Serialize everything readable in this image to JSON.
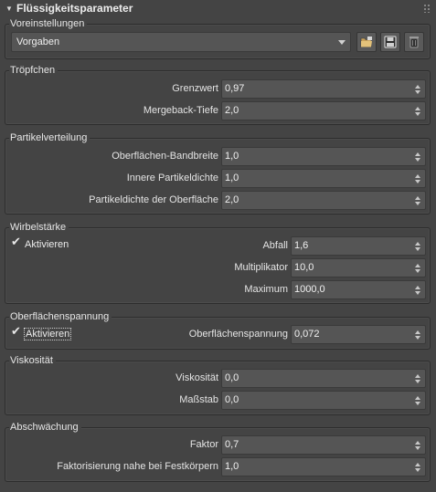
{
  "rollout": {
    "title": "Flüssigkeitsparameter"
  },
  "presets": {
    "title": "Voreinstellungen",
    "selected": "Vorgaben",
    "icons": [
      "folder-open-icon",
      "save-icon",
      "delete-icon"
    ]
  },
  "droplets": {
    "title": "Tröpfchen",
    "threshold_label": "Grenzwert",
    "threshold_value": "0,97",
    "merge_label": "Mergeback-Tiefe",
    "merge_value": "2,0"
  },
  "particle_distribution": {
    "title": "Partikelverteilung",
    "surface_band_label": "Oberflächen-Bandbreite",
    "surface_band_value": "1,0",
    "inner_density_label": "Innere Partikeldichte",
    "inner_density_value": "1,0",
    "surface_density_label": "Partikeldichte der Oberfläche",
    "surface_density_value": "2,0"
  },
  "vorticity": {
    "title": "Wirbelstärke",
    "enable_label": "Aktivieren",
    "enabled": true,
    "falloff_label": "Abfall",
    "falloff_value": "1,6",
    "multiplier_label": "Multiplikator",
    "multiplier_value": "10,0",
    "maximum_label": "Maximum",
    "maximum_value": "1000,0"
  },
  "surface_tension": {
    "title": "Oberflächenspannung",
    "enable_label": "Aktivieren",
    "enabled": true,
    "tension_label": "Oberflächenspannung",
    "tension_value": "0,072"
  },
  "viscosity": {
    "title": "Viskosität",
    "viscosity_label": "Viskosität",
    "viscosity_value": "0,0",
    "scale_label": "Maßstab",
    "scale_value": "0,0"
  },
  "damping": {
    "title": "Abschwächung",
    "factor_label": "Faktor",
    "factor_value": "0,7",
    "near_solid_label": "Faktorisierung nahe bei Festkörpern",
    "near_solid_value": "1,0"
  }
}
